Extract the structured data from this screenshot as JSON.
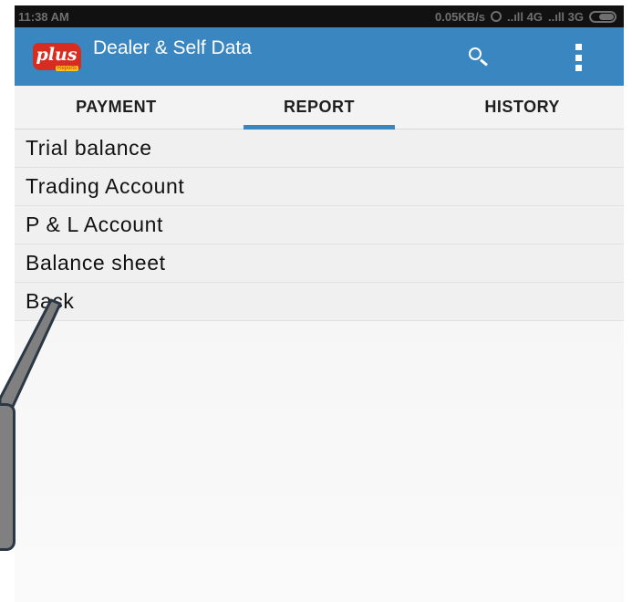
{
  "status_bar": {
    "time": "11:38 AM",
    "network_speed": "0.05KB/s",
    "signal_1": "..ıll 4G",
    "signal_2": "..ıll 3G",
    "battery_level": 0.55
  },
  "app_bar": {
    "logo_text": "plus",
    "logo_tag": "Reports",
    "title": "Dealer & Self Data",
    "icons": [
      "search-icon",
      "overflow-menu-icon"
    ]
  },
  "tabs": [
    {
      "label": "PAYMENT",
      "active": false
    },
    {
      "label": "REPORT",
      "active": true
    },
    {
      "label": "HISTORY",
      "active": false
    }
  ],
  "report_menu": [
    {
      "label": "Trial balance"
    },
    {
      "label": "Trading Account"
    },
    {
      "label": "P & L Account"
    },
    {
      "label": "Balance sheet"
    },
    {
      "label": "Back"
    }
  ],
  "colors": {
    "app_bar": "#3a86c1",
    "status_bar": "#111111",
    "tab_indicator": "#3a86c1",
    "callout": "#808080",
    "callout_border": "#2a3744"
  }
}
